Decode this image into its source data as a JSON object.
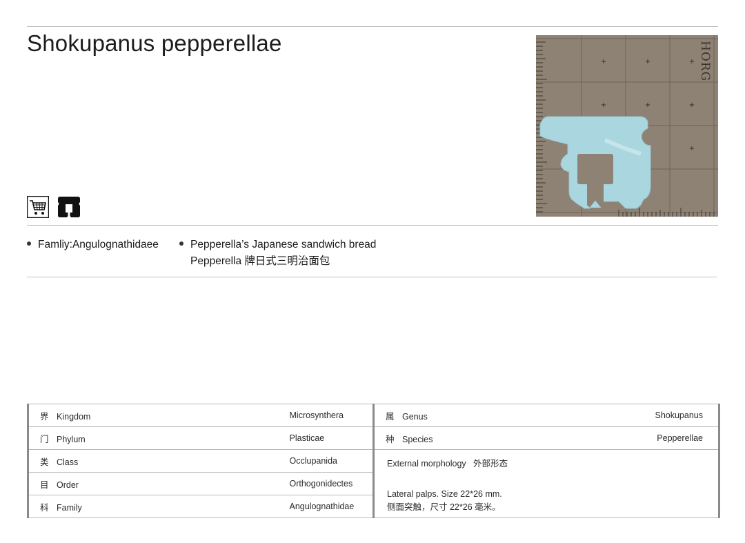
{
  "title": "Shokupanus pepperellae",
  "icons": [
    "shopping-cart-icon",
    "bread-clip-icon"
  ],
  "specimen": {
    "scale_label": "HORG"
  },
  "bullets": [
    {
      "line1": "Famliy:Angulognathidaee",
      "line2": ""
    },
    {
      "line1": "Pepperella’s Japanese sandwich bread",
      "line2": "Pepperella 牌日式三明治面包"
    }
  ],
  "taxonomy_left": [
    {
      "cn": "界",
      "label": "Kingdom",
      "value": "Microsynthera"
    },
    {
      "cn": "门",
      "label": "Phylum",
      "value": "Plasticae"
    },
    {
      "cn": "类",
      "label": "Class",
      "value": "Occlupanida"
    },
    {
      "cn": "目",
      "label": "Order",
      "value": "Orthogonidectes"
    },
    {
      "cn": "科",
      "label": "Family",
      "value": "Angulognathidae"
    }
  ],
  "taxonomy_right": [
    {
      "cn": "属",
      "label": "Genus",
      "value": "Shokupanus"
    },
    {
      "cn": "种",
      "label": "Species",
      "value": "Pepperellae"
    }
  ],
  "morphology": {
    "title": "External morphology   外部形态",
    "desc_en": "Lateral palps. Size 22*26 mm.",
    "desc_cn": "侧面突触，尺寸 22*26 毫米。"
  },
  "colors": {
    "clip": "#a9d6df",
    "background": "#8e8274",
    "rule": "#bdbdbd"
  }
}
